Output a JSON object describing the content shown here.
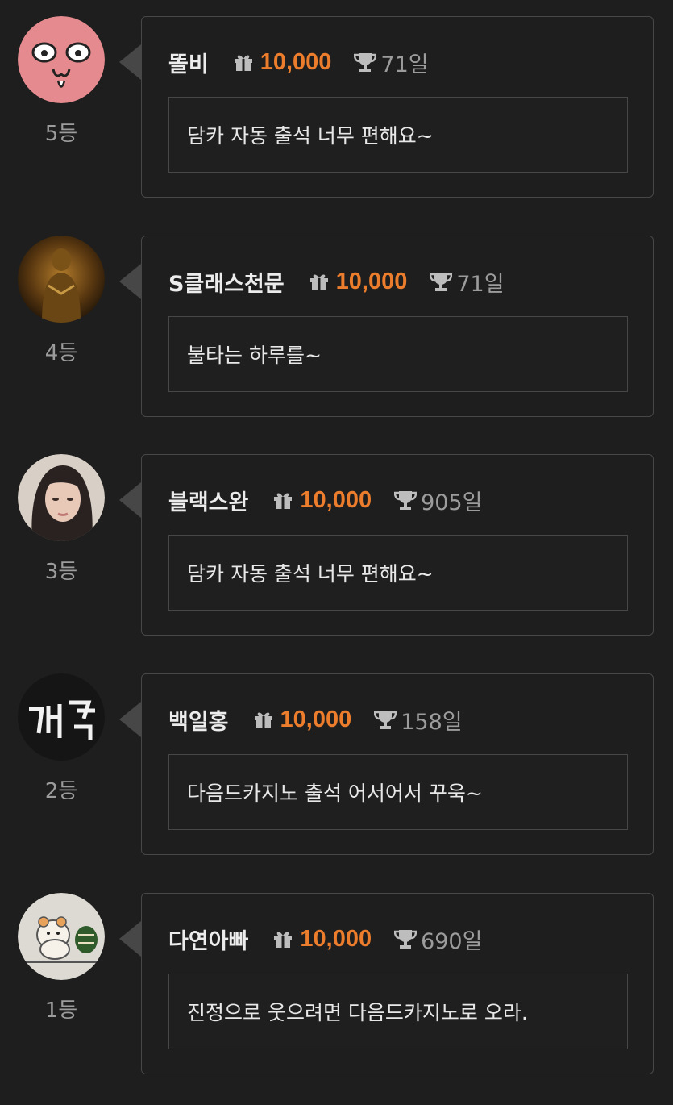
{
  "entries": [
    {
      "rank": "5등",
      "nickname": "똘비",
      "points": "10,000",
      "days": "71일",
      "message": "담카 자동 출석 너무 편해요~",
      "avatar_icon": "pink-face-avatar"
    },
    {
      "rank": "4등",
      "nickname": "S클래스천문",
      "points": "10,000",
      "days": "71일",
      "message": "불타는 하루를~",
      "avatar_icon": "golden-statue-avatar"
    },
    {
      "rank": "3등",
      "nickname": "블랙스완",
      "points": "10,000",
      "days": "905일",
      "message": "담카 자동 출석 너무 편해요~",
      "avatar_icon": "portrait-avatar"
    },
    {
      "rank": "2등",
      "nickname": "백일홍",
      "points": "10,000",
      "days": "158일",
      "message": "다음드카지노 출석 어서어서 꾸욱~",
      "avatar_icon": "neon-sign-avatar"
    },
    {
      "rank": "1등",
      "nickname": "다연아빠",
      "points": "10,000",
      "days": "690일",
      "message": "진정으로 웃으려면 다음드카지노로 오라.",
      "avatar_icon": "hamster-drawing-avatar"
    }
  ],
  "icons": {
    "points": "gift-icon",
    "days": "trophy-icon"
  },
  "colors": {
    "background": "#1e1e1e",
    "border": "#474747",
    "points_accent": "#ec7d2c",
    "muted_text": "#9c9c9c"
  }
}
